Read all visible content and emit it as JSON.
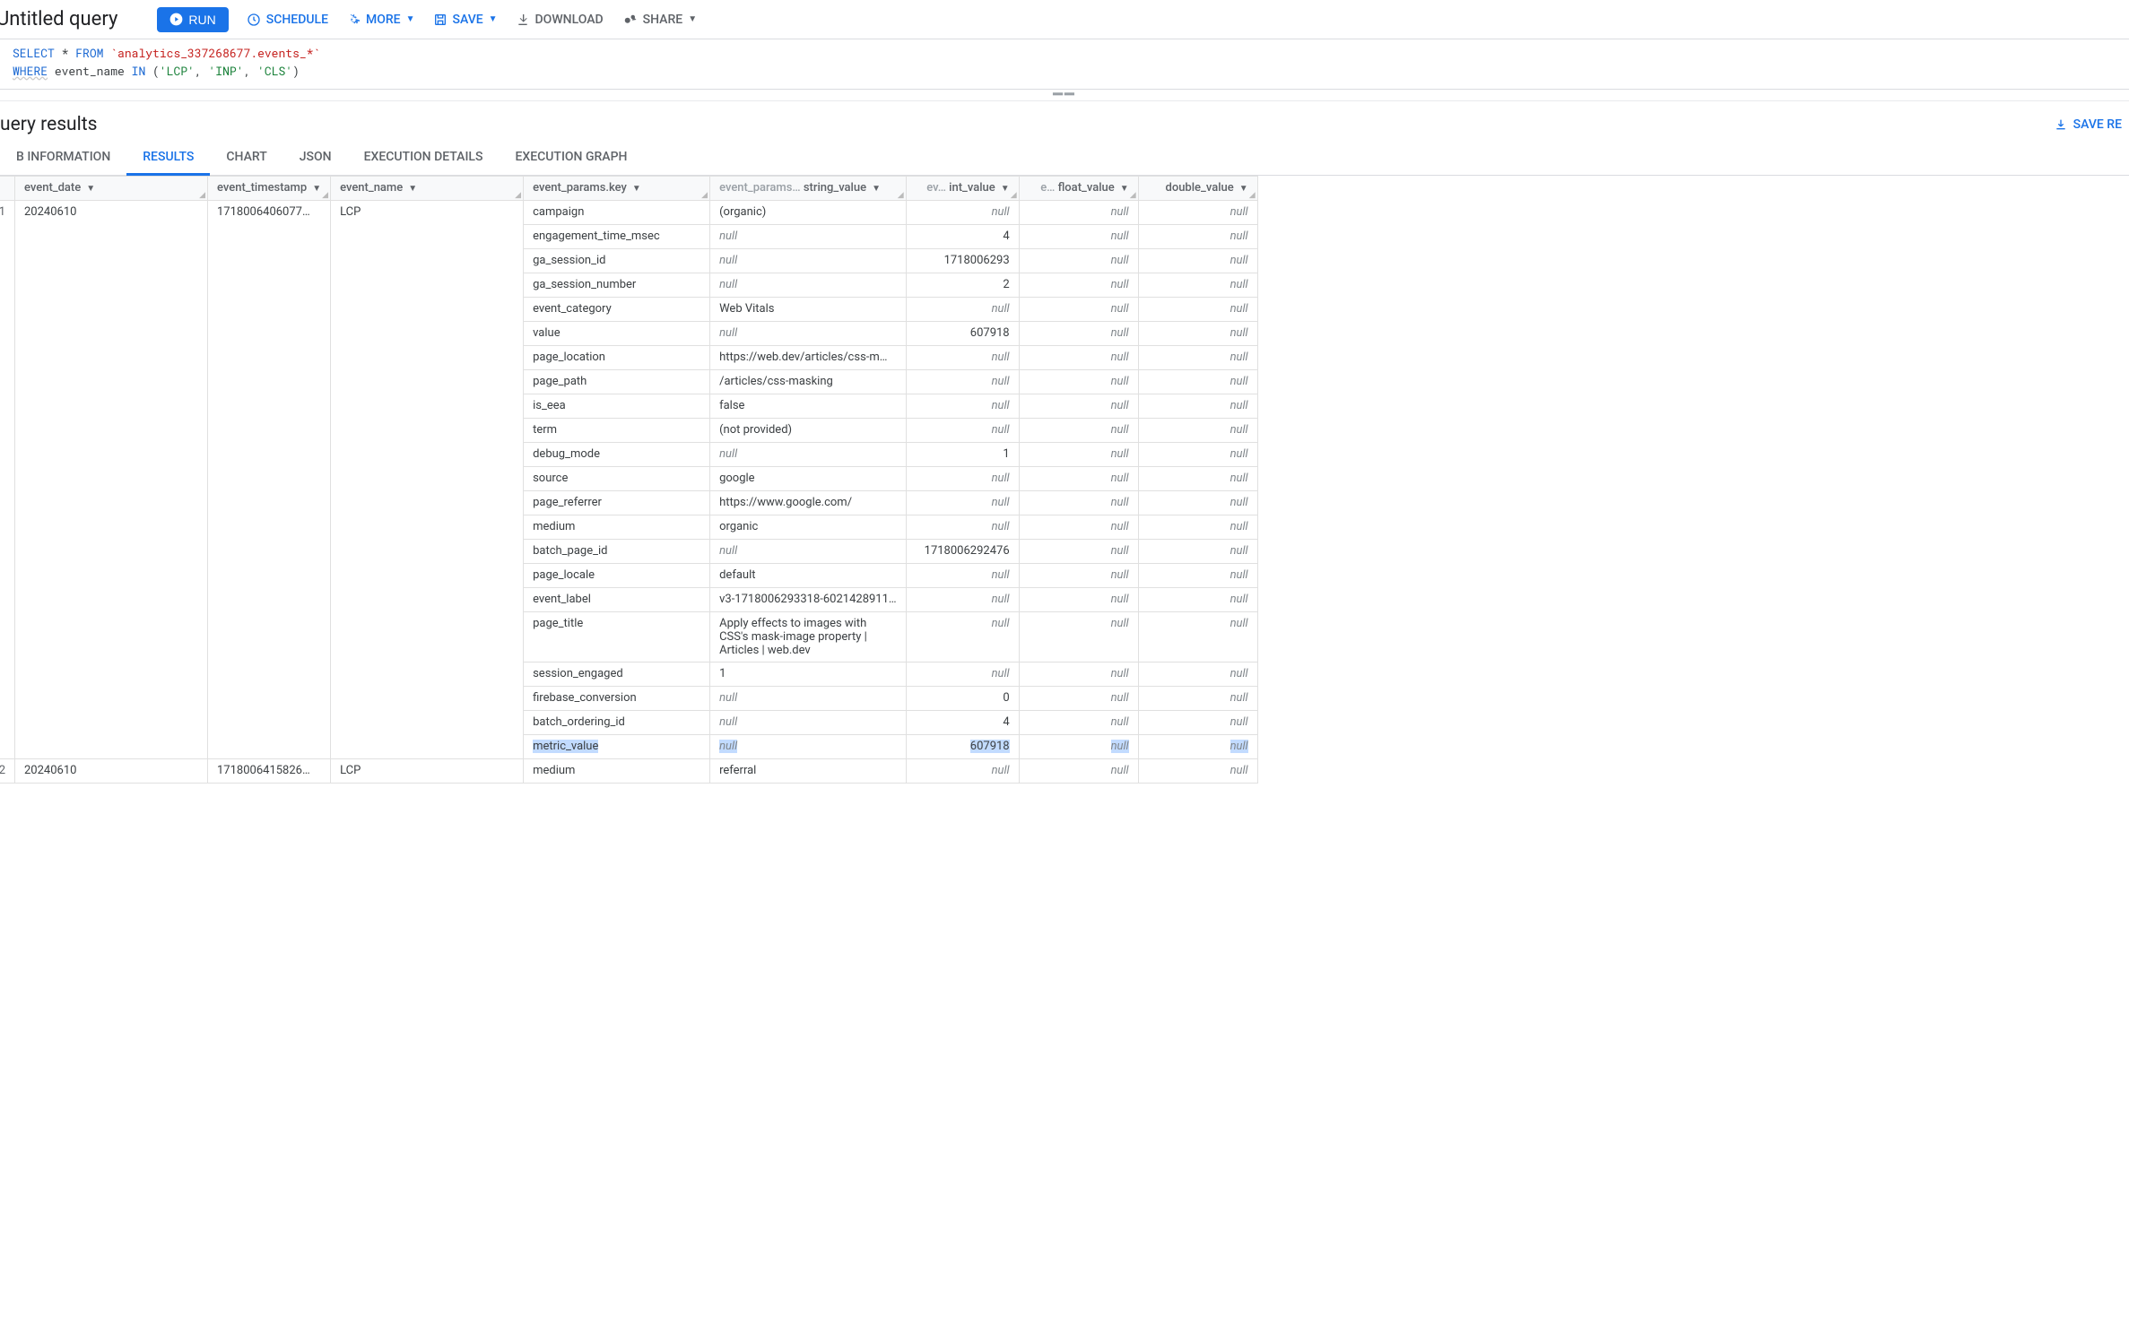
{
  "toolbar": {
    "title": "Untitled query",
    "run": "RUN",
    "schedule": "SCHEDULE",
    "more": "MORE",
    "save": "SAVE",
    "download": "DOWNLOAD",
    "share": "SHARE"
  },
  "sql": {
    "select": "SELECT",
    "star": " * ",
    "from": "FROM",
    "table": " `analytics_337268677.events_*`",
    "where": "WHERE",
    "col": " event_name ",
    "in": "IN",
    "p1": " (",
    "s1": "'LCP'",
    "c1": ", ",
    "s2": "'INP'",
    "c2": ", ",
    "s3": "'CLS'",
    "p2": ")"
  },
  "results": {
    "title": "uery results",
    "save_results": "SAVE RE"
  },
  "tabs": {
    "job": "B INFORMATION",
    "results": "RESULTS",
    "chart": "CHART",
    "json": "JSON",
    "exec": "EXECUTION DETAILS",
    "graph": "EXECUTION GRAPH"
  },
  "columns": {
    "event_date": "event_date",
    "event_timestamp": "event_timestamp",
    "event_name": "event_name",
    "key": "event_params.key",
    "sv_prefix": "event_params…",
    "sv": "string_value",
    "iv_prefix": "ev…",
    "iv": "int_value",
    "fv_prefix": "e…",
    "fv": "float_value",
    "dv": "double_value"
  },
  "null_text": "null",
  "group1": {
    "row": "1",
    "event_date": "20240610",
    "event_timestamp": "1718006406077…",
    "event_name": "LCP",
    "params": [
      {
        "key": "campaign",
        "sv": "(organic)",
        "iv": null,
        "fv": null,
        "dv": null
      },
      {
        "key": "engagement_time_msec",
        "sv": null,
        "iv": "4",
        "fv": null,
        "dv": null
      },
      {
        "key": "ga_session_id",
        "sv": null,
        "iv": "1718006293",
        "fv": null,
        "dv": null
      },
      {
        "key": "ga_session_number",
        "sv": null,
        "iv": "2",
        "fv": null,
        "dv": null
      },
      {
        "key": "event_category",
        "sv": "Web Vitals",
        "iv": null,
        "fv": null,
        "dv": null
      },
      {
        "key": "value",
        "sv": null,
        "iv": "607918",
        "fv": null,
        "dv": null
      },
      {
        "key": "page_location",
        "sv": "https://web.dev/articles/css-m…",
        "iv": null,
        "fv": null,
        "dv": null
      },
      {
        "key": "page_path",
        "sv": "/articles/css-masking",
        "iv": null,
        "fv": null,
        "dv": null
      },
      {
        "key": "is_eea",
        "sv": "false",
        "iv": null,
        "fv": null,
        "dv": null
      },
      {
        "key": "term",
        "sv": "(not provided)",
        "iv": null,
        "fv": null,
        "dv": null
      },
      {
        "key": "debug_mode",
        "sv": null,
        "iv": "1",
        "fv": null,
        "dv": null
      },
      {
        "key": "source",
        "sv": "google",
        "iv": null,
        "fv": null,
        "dv": null
      },
      {
        "key": "page_referrer",
        "sv": "https://www.google.com/",
        "iv": null,
        "fv": null,
        "dv": null
      },
      {
        "key": "medium",
        "sv": "organic",
        "iv": null,
        "fv": null,
        "dv": null
      },
      {
        "key": "batch_page_id",
        "sv": null,
        "iv": "1718006292476",
        "fv": null,
        "dv": null
      },
      {
        "key": "page_locale",
        "sv": "default",
        "iv": null,
        "fv": null,
        "dv": null
      },
      {
        "key": "event_label",
        "sv": "v3-1718006293318-6021428911…",
        "iv": null,
        "fv": null,
        "dv": null
      },
      {
        "key": "page_title",
        "sv": "Apply effects to images with CSS's mask-image property  |  Articles  |  web.dev",
        "iv": null,
        "fv": null,
        "dv": null,
        "multiline": true
      },
      {
        "key": "session_engaged",
        "sv": "1",
        "iv": null,
        "fv": null,
        "dv": null
      },
      {
        "key": "firebase_conversion",
        "sv": null,
        "iv": "0",
        "fv": null,
        "dv": null
      },
      {
        "key": "batch_ordering_id",
        "sv": null,
        "iv": "4",
        "fv": null,
        "dv": null
      },
      {
        "key": "metric_value",
        "sv": null,
        "iv": "607918",
        "fv": null,
        "dv": null,
        "hl": true
      }
    ]
  },
  "group2": {
    "row": "2",
    "event_date": "20240610",
    "event_timestamp": "1718006415826…",
    "event_name": "LCP",
    "params": [
      {
        "key": "medium",
        "sv": "referral",
        "iv": null,
        "fv": null,
        "dv": null
      }
    ]
  }
}
